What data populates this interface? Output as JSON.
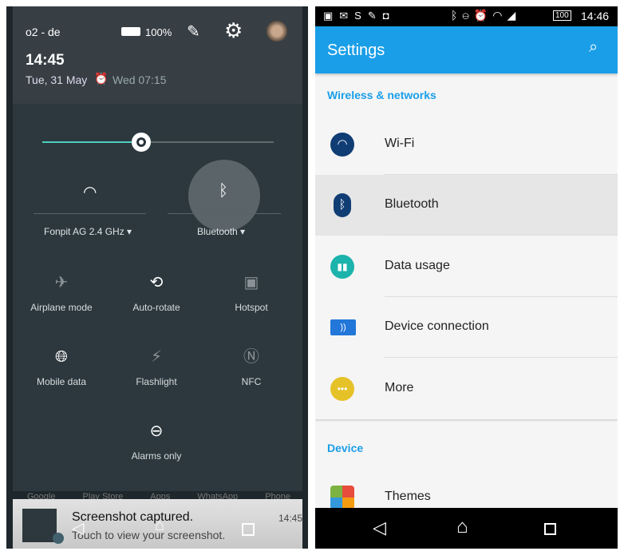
{
  "left": {
    "header": {
      "carrier": "o2 - de",
      "battery": "100%",
      "time": "14:45",
      "date": "Tue, 31 May",
      "alarm": "Wed 07:15"
    },
    "brightness_level": 0.42,
    "wifi_tile": {
      "label": "Fonpit AG 2.4 GHz"
    },
    "bluetooth_tile": {
      "label": "Bluetooth"
    },
    "tiles": [
      {
        "label": "Airplane mode",
        "icon": "airplane-icon"
      },
      {
        "label": "Auto-rotate",
        "icon": "rotate-icon"
      },
      {
        "label": "Hotspot",
        "icon": "hotspot-icon"
      },
      {
        "label": "Mobile data",
        "icon": "globe-icon"
      },
      {
        "label": "Flashlight",
        "icon": "flashlight-icon"
      },
      {
        "label": "NFC",
        "icon": "nfc-icon"
      },
      {
        "label": "Alarms only",
        "icon": "do-not-disturb-icon"
      }
    ],
    "dock": [
      "Google",
      "Play Store",
      "Apps",
      "WhatsApp",
      "Phone"
    ],
    "notification": {
      "title": "Screenshot captured.",
      "text": "Touch to view your screenshot.",
      "time": "14:45"
    }
  },
  "right": {
    "status": {
      "battery": "100",
      "time": "14:46"
    },
    "title": "Settings",
    "sections": [
      {
        "header": "Wireless & networks",
        "items": [
          "Wi-Fi",
          "Bluetooth",
          "Data usage",
          "Device connection",
          "More"
        ]
      },
      {
        "header": "Device",
        "items": [
          "Themes"
        ]
      }
    ],
    "accent": "#1a9ee8"
  }
}
